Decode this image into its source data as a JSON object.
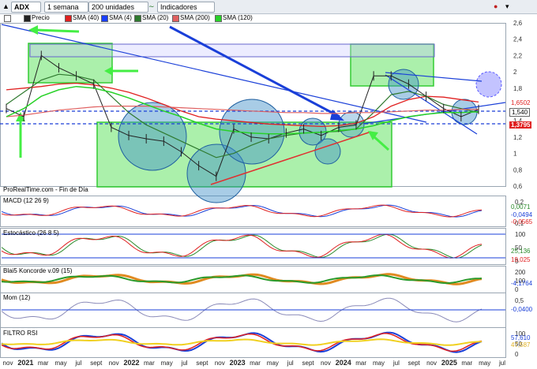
{
  "toolbar": {
    "ticker": "ADX",
    "period": "1 semana",
    "units": "200 unidades",
    "indicators": "Indicadores"
  },
  "legend": {
    "price": "Precio",
    "sma40": "SMA (40)",
    "sma4": "SMA (4)",
    "sma20": "SMA (20)",
    "sma200": "SMA (200)",
    "sma120": "SMA (120)"
  },
  "source": "ProRealTime.com - Fin de Día",
  "panels": {
    "macd": "MACD (12 26 9)",
    "stoch": "Estocástico (26 8 5)",
    "koncorde": "Blai5 Koncorde v.09 (15)",
    "mom": "Mom (12)",
    "rsi": "FILTRO RSI"
  },
  "colors": {
    "price": "#222222",
    "sma40": "#e02020",
    "sma4": "#1a3fff",
    "sma20": "#2f7a2f",
    "sma200": "#e06060",
    "sma120": "#28d228",
    "trend_blue": "#1a3fd8",
    "trend_red": "#e03030",
    "box_green": "#44dd44",
    "circle": "#3d8fc8"
  },
  "price_tags": {
    "t1": "1,6502",
    "t2": "1,540",
    "t3": "1,3795"
  },
  "panel_tags": {
    "macd": [
      "0,0071",
      "-0,0494",
      "-0,0565"
    ],
    "stoch": [
      "25,136",
      "19,025"
    ],
    "koncorde": "-4,1764",
    "mom": "-0,0400",
    "rsi": [
      "57,610",
      "47,587"
    ]
  },
  "chart_data": {
    "type": "line",
    "title": "ADX",
    "y_ticks_price": [
      "2,6",
      "2,4",
      "2,2",
      "2",
      "1,8",
      "1,4",
      "1,2",
      "1",
      "0,8",
      "0,6"
    ],
    "y_ticks_macd": [
      "0,2",
      "0,1"
    ],
    "y_ticks_stoch": [
      "100",
      "50",
      "0"
    ],
    "y_ticks_koncorde": [
      "200",
      "100",
      "0"
    ],
    "y_ticks_mom": [
      "0,5"
    ],
    "y_ticks_rsi": [
      "100",
      "50",
      "0"
    ],
    "x_ticks": [
      "nov",
      "2021",
      "mar",
      "may",
      "jul",
      "sept",
      "nov",
      "2022",
      "mar",
      "may",
      "jul",
      "sept",
      "nov",
      "2023",
      "mar",
      "may",
      "jul",
      "sept",
      "nov",
      "2024",
      "mar",
      "may",
      "jul",
      "sept",
      "nov",
      "2025",
      "mar",
      "may",
      "jul"
    ],
    "x": [
      "2020-11",
      "2021-01",
      "2021-03",
      "2021-05",
      "2021-07",
      "2021-09",
      "2021-11",
      "2022-01",
      "2022-03",
      "2022-05",
      "2022-07",
      "2022-09",
      "2022-11",
      "2023-01",
      "2023-03",
      "2023-05",
      "2023-07",
      "2023-09",
      "2023-11",
      "2024-01",
      "2024-03",
      "2024-05",
      "2024-07",
      "2024-09",
      "2024-11",
      "2025-01",
      "2025-03",
      "2025-05"
    ],
    "series": [
      {
        "name": "Precio",
        "values": [
          1.55,
          1.45,
          2.2,
          2.05,
          1.95,
          1.85,
          1.32,
          1.22,
          1.18,
          1.15,
          1.02,
          0.85,
          0.72,
          1.3,
          1.2,
          1.18,
          1.25,
          1.3,
          1.22,
          1.32,
          1.35,
          1.95,
          1.95,
          1.85,
          1.7,
          1.55,
          1.45,
          1.54
        ]
      },
      {
        "name": "SMA (40)",
        "values": [
          1.78,
          1.8,
          1.82,
          1.85,
          1.86,
          1.84,
          1.8,
          1.75,
          1.68,
          1.6,
          1.52,
          1.45,
          1.42,
          1.4,
          1.38,
          1.36,
          1.35,
          1.34,
          1.33,
          1.34,
          1.37,
          1.45,
          1.58,
          1.66,
          1.7,
          1.69,
          1.66,
          1.63
        ]
      },
      {
        "name": "SMA (20)",
        "values": [
          1.6,
          1.75,
          1.9,
          1.97,
          1.95,
          1.9,
          1.7,
          1.5,
          1.35,
          1.25,
          1.15,
          1.05,
          0.95,
          1.0,
          1.1,
          1.18,
          1.22,
          1.25,
          1.26,
          1.27,
          1.3,
          1.5,
          1.72,
          1.76,
          1.7,
          1.6,
          1.55,
          1.5
        ]
      },
      {
        "name": "SMA (200)",
        "values": [
          1.45,
          1.47,
          1.5,
          1.53,
          1.55,
          1.57,
          1.58,
          1.58,
          1.58,
          1.57,
          1.56,
          1.55,
          1.54,
          1.53,
          1.52,
          1.51,
          1.5,
          1.5,
          1.49,
          1.49,
          1.5,
          1.5,
          1.51,
          1.52,
          1.53,
          1.53,
          1.54,
          1.54
        ]
      },
      {
        "name": "SMA (120)",
        "values": [
          1.45,
          1.55,
          1.7,
          1.78,
          1.82,
          1.8,
          1.75,
          1.68,
          1.6,
          1.52,
          1.45,
          1.37,
          1.3,
          1.27,
          1.25,
          1.24,
          1.24,
          1.25,
          1.26,
          1.28,
          1.3,
          1.34,
          1.4,
          1.45,
          1.48,
          1.5,
          1.5,
          1.51
        ]
      }
    ],
    "ylim": [
      0.6,
      2.6
    ]
  }
}
